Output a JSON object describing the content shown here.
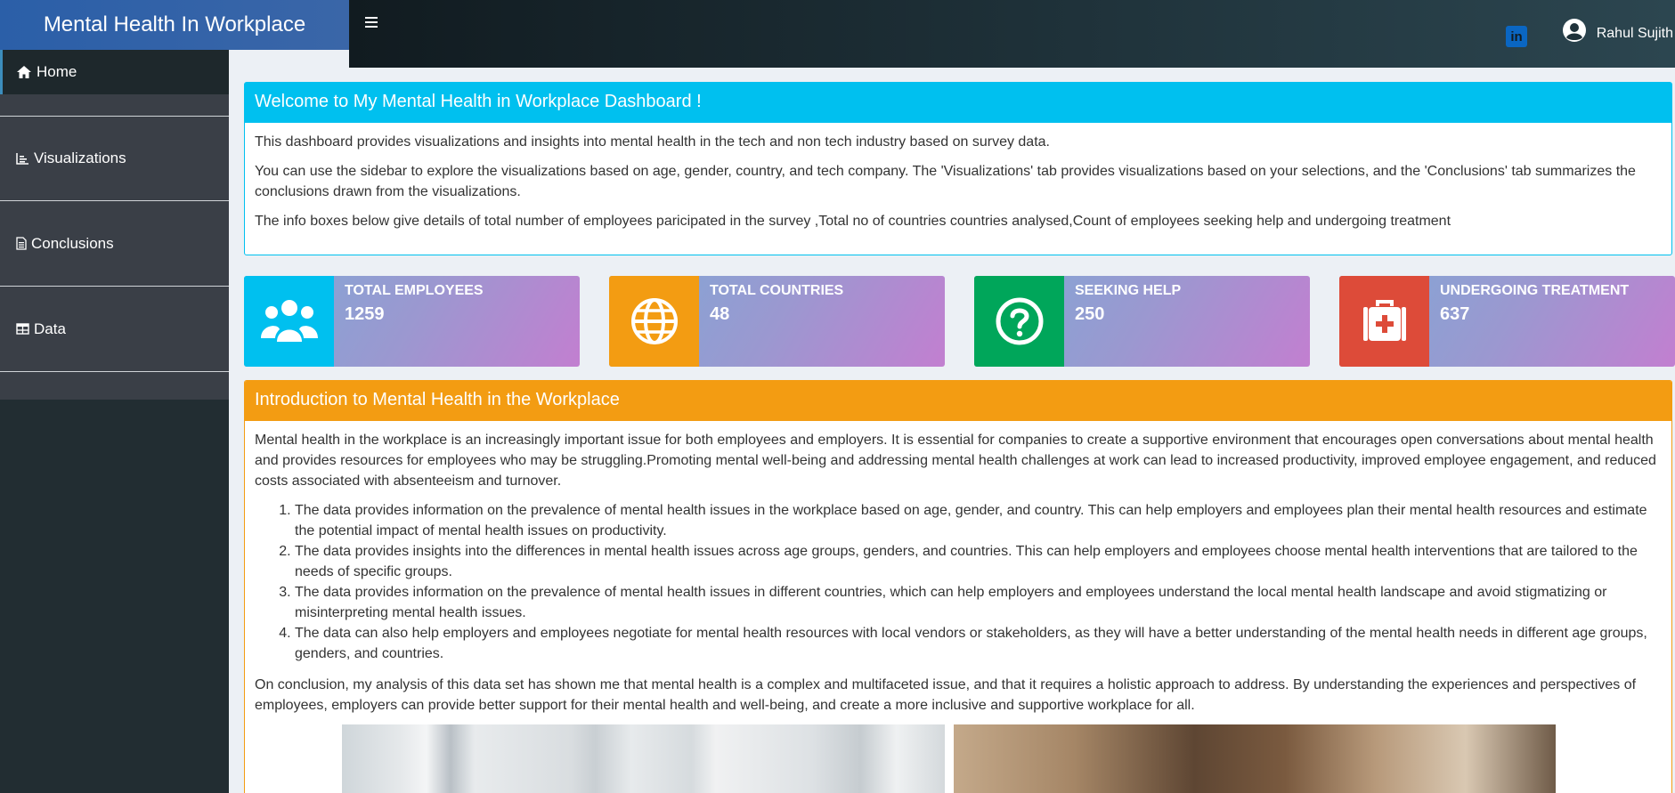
{
  "header": {
    "logo_text": "Mental Health In Workplace",
    "user_name": "Rahul Sujith",
    "linkedin_icon": "linkedin-icon",
    "user_icon": "user-circle-icon"
  },
  "sidebar": {
    "items": [
      {
        "label": "Home",
        "icon": "home-icon"
      },
      {
        "label": "Visualizations",
        "icon": "chart-icon"
      },
      {
        "label": "Conclusions",
        "icon": "document-icon"
      },
      {
        "label": "Data",
        "icon": "table-icon"
      }
    ]
  },
  "welcome": {
    "title": "Welcome to My Mental Health in Workplace Dashboard !",
    "p1": "This dashboard provides visualizations and insights into mental health in the tech and non tech industry based on survey data.",
    "p2": "You can use the sidebar to explore the visualizations based on age, gender, country, and tech company. The 'Visualizations' tab provides visualizations based on your selections, and the 'Conclusions' tab summarizes the conclusions drawn from the visualizations.",
    "p3": "The info boxes below give details of total number of employees paricipated in the survey ,Total no of countries countries analysed,Count of employees seeking help and undergoing treatment"
  },
  "info_boxes": [
    {
      "label": "Total Employees",
      "value": "1259",
      "icon": "users-icon",
      "color": "#00c0ef"
    },
    {
      "label": "Total Countries",
      "value": "48",
      "icon": "globe-icon",
      "color": "#f39c12"
    },
    {
      "label": "Seeking Help",
      "value": "250",
      "icon": "question-circle-icon",
      "color": "#00a65a"
    },
    {
      "label": "Undergoing Treatment",
      "value": "637",
      "icon": "medkit-icon",
      "color": "#dd4b39"
    }
  ],
  "intro": {
    "title": "Introduction to Mental Health in the Workplace",
    "p1": "Mental health in the workplace is an increasingly important issue for both employees and employers. It is essential for companies to create a supportive environment that encourages open conversations about mental health and provides resources for employees who may be struggling.Promoting mental well-being and addressing mental health challenges at work can lead to increased productivity, improved employee engagement, and reduced costs associated with absenteeism and turnover.",
    "list": [
      "The data provides information on the prevalence of mental health issues in the workplace based on age, gender, and country. This can help employers and employees plan their mental health resources and estimate the potential impact of mental health issues on productivity.",
      "The data provides insights into the differences in mental health issues across age groups, genders, and countries. This can help employers and employees choose mental health interventions that are tailored to the needs of specific groups.",
      "The data provides information on the prevalence of mental health issues in different countries, which can help employers and employees understand the local mental health landscape and avoid stigmatizing or misinterpreting mental health issues.",
      "The data can also help employers and employees negotiate for mental health resources with local vendors or stakeholders, as they will have a better understanding of the mental health needs in different age groups, genders, and countries."
    ],
    "p2": "On conclusion, my analysis of this data set has shown me that mental health is a complex and multifaceted issue, and that it requires a holistic approach to address. By understanding the experiences and perspectives of employees, employers can provide better support for their mental health and well-being, and create a more inclusive and supportive workplace for all."
  }
}
